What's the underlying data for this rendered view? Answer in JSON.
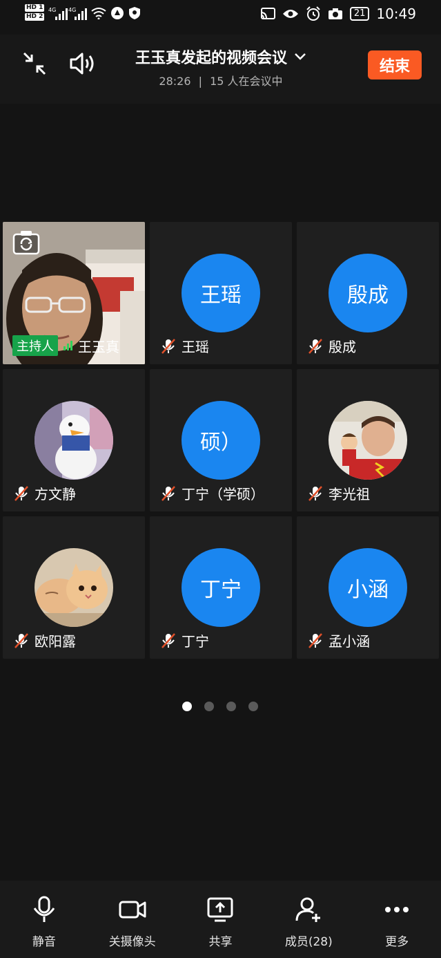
{
  "status_bar": {
    "hd1": "HD 1",
    "hd2": "HD 2",
    "net1": "4G",
    "net2": "4G",
    "battery": "21",
    "time": "10:49"
  },
  "header": {
    "title": "王玉真发起的视频会议",
    "duration": "28:26",
    "separator": "|",
    "participants_text": "15 人在会议中",
    "end_label": "结束"
  },
  "tiles": [
    {
      "name": "王玉真",
      "host_badge": "主持人",
      "type": "video"
    },
    {
      "name": "王瑶",
      "avatar_text": "王瑶",
      "type": "initials"
    },
    {
      "name": "殷成",
      "avatar_text": "殷成",
      "type": "initials"
    },
    {
      "name": "方文静",
      "type": "photo",
      "photo": "duck-figure"
    },
    {
      "name": "丁宁（学硕）",
      "avatar_text": "硕）",
      "type": "initials"
    },
    {
      "name": "李光祖",
      "type": "photo",
      "photo": "man-with-toy"
    },
    {
      "name": "欧阳露",
      "type": "photo",
      "photo": "kittens"
    },
    {
      "name": "丁宁",
      "avatar_text": "丁宁",
      "type": "initials"
    },
    {
      "name": "孟小涵",
      "avatar_text": "小涵",
      "type": "initials"
    }
  ],
  "pager": {
    "total": 4,
    "active": 1
  },
  "toolbar": {
    "mute": "静音",
    "camera": "关摄像头",
    "share": "共享",
    "members": "成员(28)",
    "more": "更多"
  },
  "colors": {
    "avatar_blue": "#1a86f0",
    "end_button": "#fa5a23",
    "host_badge": "#17a34a",
    "mic_muted_slash": "#e0502a"
  }
}
